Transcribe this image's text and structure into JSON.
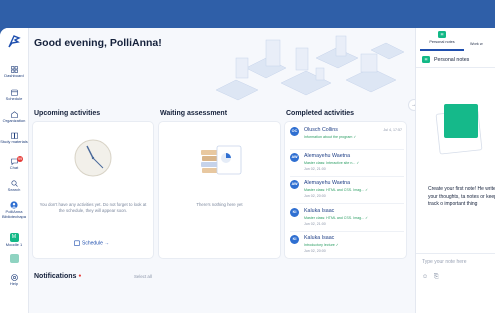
{
  "greeting": "Good evening, PolliAnna!",
  "sidebar": {
    "items": [
      {
        "label": "Dashboard",
        "icon": "dashboard-icon"
      },
      {
        "label": "Schedule",
        "icon": "calendar-icon"
      },
      {
        "label": "Organization",
        "icon": "building-icon"
      },
      {
        "label": "Study materials",
        "icon": "book-icon"
      },
      {
        "label": "Chat",
        "icon": "chat-icon",
        "badge": "99"
      },
      {
        "label": "Search",
        "icon": "search-icon"
      },
      {
        "label": "PolliAnna Bibliotechapa",
        "icon": "avatar-icon"
      },
      {
        "label": "Moodle 1",
        "icon": "module-icon",
        "box": "M"
      },
      {
        "label": "Help",
        "icon": "help-icon"
      }
    ]
  },
  "sections": {
    "upcoming": {
      "title": "Upcoming activities",
      "empty_text": "You don't have any activities yet. Do not forget to look at the schedule, they will appear soon.",
      "schedule_link": "Schedule"
    },
    "waiting": {
      "title": "Waiting assessment",
      "empty_text": "There's nothing here yet"
    },
    "completed": {
      "title": "Completed activities",
      "items": [
        {
          "initials": "OC",
          "name": "Olusch Collins",
          "desc": "Information about the program ✓",
          "date": "",
          "time": "Jul 4, 17:57"
        },
        {
          "initials": "AW",
          "name": "Alemayehu Waetna",
          "desc": "Master class: Interactive site n... ✓",
          "date": "Jun 02, 21:00",
          "time": ""
        },
        {
          "initials": "AW",
          "name": "Alemayehu Waetna",
          "desc": "Master class: HTML and CSS. Imag... ✓",
          "date": "Jun 02, 20:00",
          "time": ""
        },
        {
          "initials": "KI",
          "name": "Kaluka Isaac",
          "desc": "Master class: HTML and CSS. Imag... ✓",
          "date": "Jun 02, 21:00",
          "time": ""
        },
        {
          "initials": "KI",
          "name": "Kaluka Isaac",
          "desc": "Introductory lecture ✓",
          "date": "Jun 02, 20:00",
          "time": ""
        }
      ]
    }
  },
  "notifications": {
    "title": "Notifications",
    "select_all": "Select all"
  },
  "right_panel": {
    "tabs": [
      {
        "label": "Personal notes",
        "icon": "note-icon"
      },
      {
        "label": "Work w",
        "icon": "work-icon"
      }
    ],
    "header_title": "Personal notes",
    "empty_text": "Create your first note! He write your thoughts, ta notes or keep track o important thing",
    "input_placeholder": "Type your note here"
  },
  "colors": {
    "accent": "#1f4fae",
    "brand_green": "#12b886",
    "top_bar": "#2f5fa8",
    "badge_red": "#e53935"
  }
}
